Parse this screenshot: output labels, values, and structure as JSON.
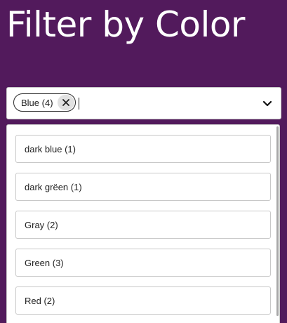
{
  "page": {
    "title": "Filter by Color"
  },
  "combobox": {
    "selected_chip": {
      "label": "Blue (4)",
      "remove_icon": "close-icon"
    },
    "input_value": "",
    "toggle_icon": "chevron-down-icon"
  },
  "options": [
    {
      "label": "dark blue (1)"
    },
    {
      "label": "dark grëen (1)"
    },
    {
      "label": "Gray (2)"
    },
    {
      "label": "Green (3)"
    },
    {
      "label": "Red (2)"
    }
  ],
  "colors": {
    "background": "#521a5c",
    "surface": "#ffffff",
    "border": "#c8c8c8",
    "text": "#222222",
    "chip_remove_bg": "#e1e1e1"
  }
}
